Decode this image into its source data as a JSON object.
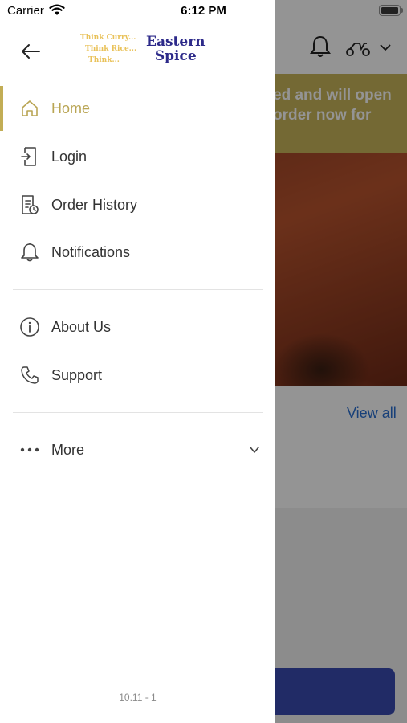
{
  "status_bar": {
    "carrier": "Carrier",
    "time": "6:12 PM"
  },
  "background": {
    "banner_text_line1": "ed and will open",
    "banner_text_line2": "order now for",
    "view_all": "View all"
  },
  "drawer": {
    "logo": {
      "tagline_1": "Think Curry...",
      "tagline_2": "Think Rice...",
      "tagline_3": "Think...",
      "brand_line1": "Eastern",
      "brand_line2": "Spice"
    },
    "items": [
      {
        "label": "Home",
        "icon": "home-icon",
        "active": true
      },
      {
        "label": "Login",
        "icon": "login-icon"
      },
      {
        "label": "Order History",
        "icon": "order-history-icon"
      },
      {
        "label": "Notifications",
        "icon": "bell-icon"
      },
      {
        "label": "About Us",
        "icon": "info-icon"
      },
      {
        "label": "Support",
        "icon": "phone-icon"
      },
      {
        "label": "More",
        "icon": "more-dots-icon"
      }
    ],
    "version": "10.11 - 1"
  },
  "colors": {
    "accent": "#c2ad55",
    "brand_blue": "#2d2a8a",
    "banner": "#c9b55a"
  }
}
